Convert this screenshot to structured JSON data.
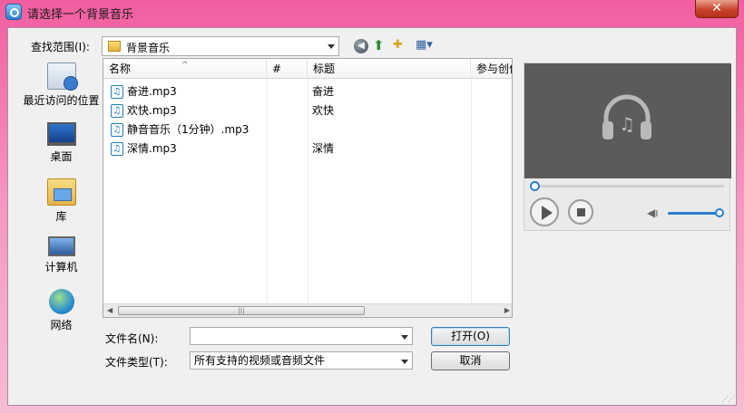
{
  "window": {
    "title": "请选择一个背景音乐",
    "close_label": "✕"
  },
  "lookin": {
    "label": "查找范围(I):",
    "value": "背景音乐"
  },
  "toolbar": {
    "back_icon": "back-arrow-icon",
    "up_icon": "up-folder-icon",
    "newfolder_icon": "new-folder-icon",
    "view_icon": "view-menu-icon"
  },
  "places": [
    {
      "label": "最近访问的位置",
      "icon": "recent-places-icon"
    },
    {
      "label": "桌面",
      "icon": "desktop-icon"
    },
    {
      "label": "库",
      "icon": "library-icon"
    },
    {
      "label": "计算机",
      "icon": "computer-icon"
    },
    {
      "label": "网络",
      "icon": "network-icon"
    }
  ],
  "list": {
    "headers": [
      "名称",
      "#",
      "标题",
      "参与创作"
    ],
    "rows": [
      {
        "name": "奋进.mp3",
        "title": "奋进"
      },
      {
        "name": "欢快.mp3",
        "title": "欢快"
      },
      {
        "name": "静音音乐（1分钟）.mp3",
        "title": ""
      },
      {
        "name": "深情.mp3",
        "title": "深情"
      }
    ]
  },
  "filename": {
    "label": "文件名(N):",
    "value": ""
  },
  "filetype": {
    "label": "文件类型(T):",
    "value": "所有支持的视频或音频文件"
  },
  "buttons": {
    "open": "打开(O)",
    "cancel": "取消"
  },
  "preview": {
    "progress": 0,
    "volume": 0.95
  }
}
